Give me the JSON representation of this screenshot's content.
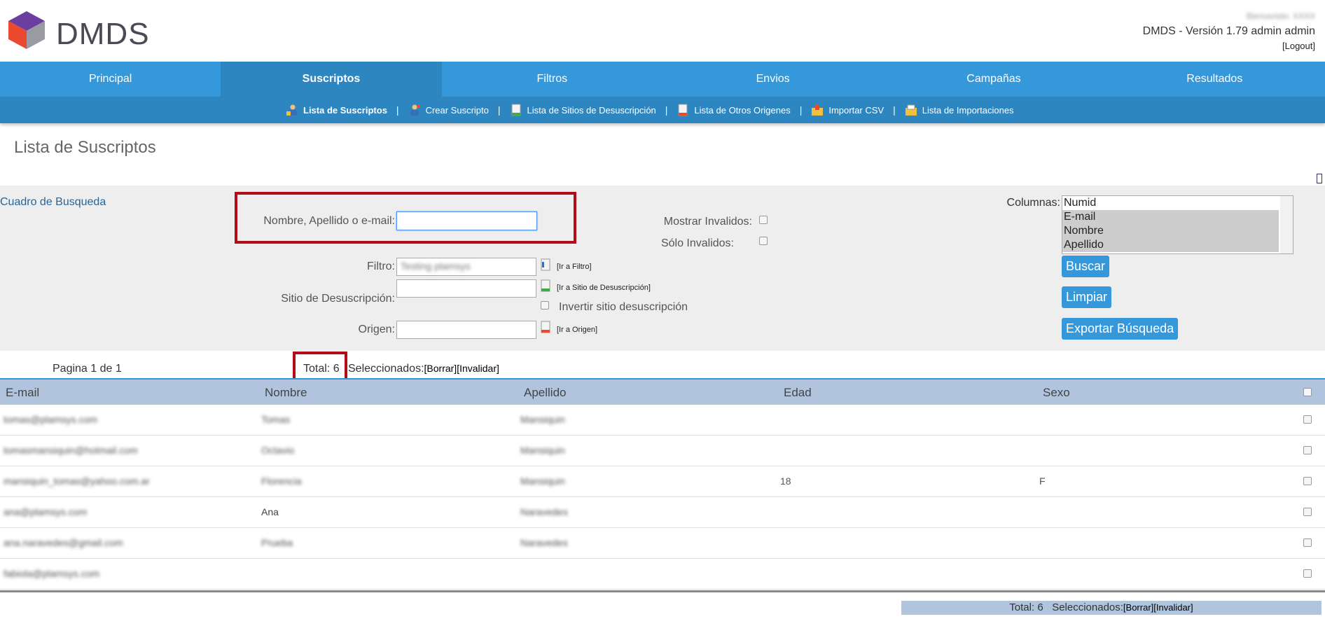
{
  "header": {
    "logo_text": "DMDS",
    "welcome": "Bienvenido: XXXX",
    "version": "DMDS - Versión 1.79 admin admin",
    "logout": "[Logout]"
  },
  "nav": {
    "tabs": [
      "Principal",
      "Suscriptos",
      "Filtros",
      "Envios",
      "Campañas",
      "Resultados"
    ],
    "active": "Suscriptos"
  },
  "subnav": {
    "items": [
      "Lista de Suscriptos",
      "Crear Suscripto",
      "Lista de Sitios de Desuscripción",
      "Lista de Otros Origenes",
      "Importar CSV",
      "Lista de Importaciones"
    ],
    "separator": "|"
  },
  "page_title": "Lista de Suscriptos",
  "search": {
    "title": "Cuadro de Busqueda",
    "name_label": "Nombre, Apellido o e-mail:",
    "name_value": "",
    "mostrar_invalidos": "Mostrar Invalidos:",
    "solo_invalidos": "Sólo Invalidos:",
    "filtro_label": "Filtro:",
    "filtro_value": "Testing plamsys",
    "filtro_link": "[Ir a Filtro]",
    "sitio_label": "Sitio de Desuscripción:",
    "sitio_link": "[Ir a Sitio de Desuscripción]",
    "invertir_label": "Invertir sitio desuscripción",
    "origen_label": "Origen:",
    "origen_link": "[Ir a Origen]",
    "columnas_label": "Columnas:",
    "columnas_options": [
      "Numid",
      "E-mail",
      "Nombre",
      "Apellido"
    ],
    "buscar": "Buscar",
    "limpiar": "Limpiar",
    "exportar": "Exportar Búsqueda"
  },
  "pagination": {
    "page_label": "Pagina 1 de 1",
    "total": "Total: 6",
    "seleccionados": "Seleccionados:",
    "actions": "[Borrar][Invalidar]"
  },
  "table": {
    "columns": [
      "E-mail",
      "Nombre",
      "Apellido",
      "Edad",
      "Sexo"
    ],
    "rows": [
      {
        "email": "tomas@plamsys.com",
        "nombre": "Tomas",
        "apellido": "Mansiquin",
        "edad": "",
        "sexo": ""
      },
      {
        "email": "tomasmansiquin@hotmail.com",
        "nombre": "Octavio",
        "apellido": "Mansiquin",
        "edad": "",
        "sexo": ""
      },
      {
        "email": "mansiquin_tomas@yahoo.com.ar",
        "nombre": "Florencia",
        "apellido": "Mansiquin",
        "edad": "18",
        "sexo": "F"
      },
      {
        "email": "ana@plamsys.com",
        "nombre": "Ana",
        "apellido": "Naravedes",
        "edad": "",
        "sexo": ""
      },
      {
        "email": "ana.naravedes@gmail.com",
        "nombre": "Prueba",
        "apellido": "Naravedes",
        "edad": "",
        "sexo": ""
      },
      {
        "email": "fabiola@plamsys.com",
        "nombre": "",
        "apellido": "",
        "edad": "",
        "sexo": ""
      }
    ]
  },
  "footer": {
    "total": "Total: 6",
    "seleccionados": "Seleccionados:",
    "actions": "[Borrar][Invalidar]"
  },
  "colors": {
    "nav": "#3498db",
    "nav_active": "#2e86c1",
    "highlight": "#b00d18",
    "table_head": "#b0c4de"
  }
}
